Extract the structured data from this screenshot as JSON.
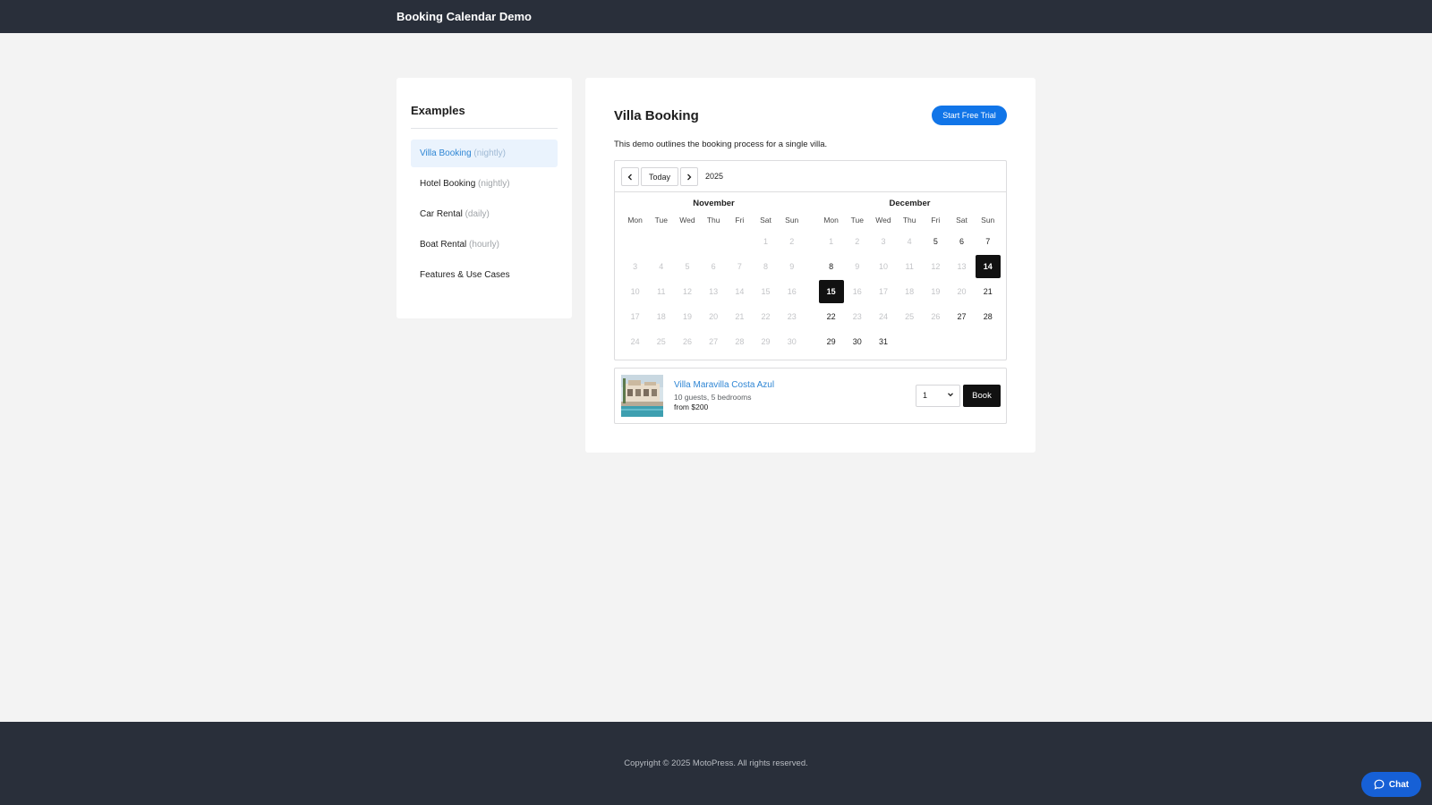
{
  "app": {
    "title": "Booking Calendar Demo"
  },
  "sidebar": {
    "heading": "Examples",
    "items": [
      {
        "label": "Villa Booking",
        "sub": "(nightly)",
        "active": true
      },
      {
        "label": "Hotel Booking",
        "sub": "(nightly)",
        "active": false
      },
      {
        "label": "Car Rental",
        "sub": "(daily)",
        "active": false
      },
      {
        "label": "Boat Rental",
        "sub": "(hourly)",
        "active": false
      },
      {
        "label": "Features & Use Cases",
        "sub": "",
        "active": false
      }
    ]
  },
  "main": {
    "title": "Villa Booking",
    "cta_label": "Start Free Trial",
    "description": "This demo outlines the booking process for a single villa."
  },
  "calendar": {
    "today_label": "Today",
    "year": "2025",
    "weekdays": [
      "Mon",
      "Tue",
      "Wed",
      "Thu",
      "Fri",
      "Sat",
      "Sun"
    ],
    "months": [
      {
        "name": "November",
        "leading_blanks": 5,
        "days": 30,
        "available": [],
        "selected": []
      },
      {
        "name": "December",
        "leading_blanks": 0,
        "days": 31,
        "available": [
          5,
          6,
          7,
          8,
          14,
          15,
          21,
          22,
          27,
          28,
          29,
          30,
          31
        ],
        "selected": [
          14,
          15
        ]
      }
    ]
  },
  "listing": {
    "name": "Villa Maravilla Costa Azul",
    "meta": "10 guests, 5 bedrooms",
    "price": "from $200",
    "quantity": "1",
    "book_label": "Book"
  },
  "footer": {
    "copyright": "Copyright © 2025 MotoPress. All rights reserved."
  },
  "chat": {
    "label": "Chat"
  },
  "colors": {
    "accent": "#1175e8",
    "header_bg": "#292f3a",
    "selected_bg": "#111111",
    "link": "#2f86d4"
  }
}
